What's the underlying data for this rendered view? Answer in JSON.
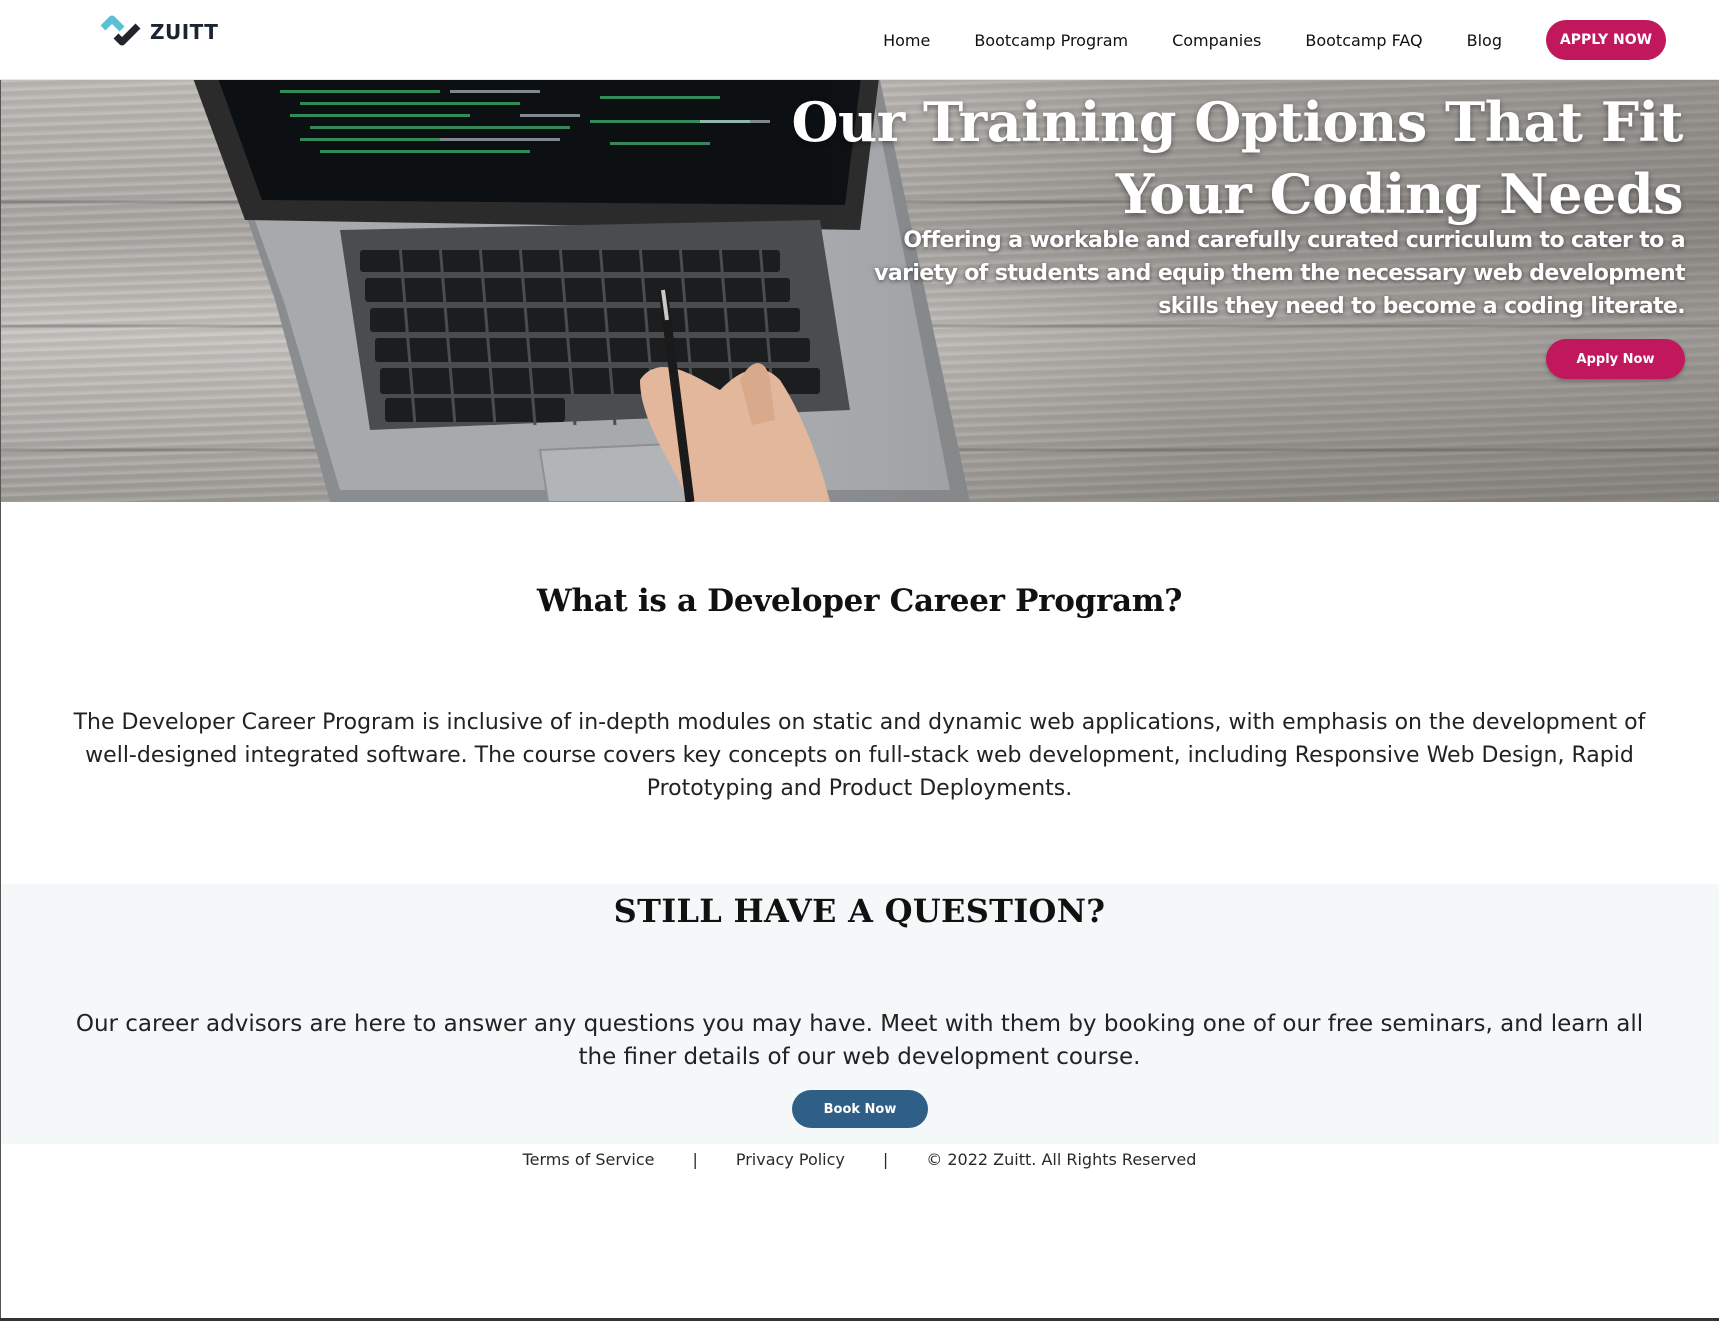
{
  "brand": {
    "name": "ZUITT"
  },
  "nav": {
    "links": [
      "Home",
      "Bootcamp Program",
      "Companies",
      "Bootcamp FAQ",
      "Blog"
    ],
    "apply_label": "APPLY NOW"
  },
  "hero": {
    "title_line1": "Our Training Options That Fit",
    "title_line2": "Your Coding Needs",
    "subtitle": "Offering a workable and carefully curated curriculum to cater to a variety of students and equip them the necessary web development skills they need to become a coding literate.",
    "apply_label": "Apply Now"
  },
  "program": {
    "title": "What is a Developer Career Program?",
    "text": "The Developer Career Program is inclusive of in-depth modules on static and dynamic web applications, with emphasis on the development of well-designed integrated software. The course covers key concepts on full-stack web development, including Responsive Web Design, Rapid Prototyping and Product Deployments."
  },
  "question": {
    "title": "STILL HAVE A QUESTION?",
    "text": "Our career advisors are here to answer any questions you may have. Meet with them by booking one of our free seminars, and learn all the finer details of our web development course.",
    "book_label": "Book Now"
  },
  "footer": {
    "terms": "Terms of Service",
    "separator": "|",
    "privacy": "Privacy Policy",
    "copyright": "© 2022 Zuitt. All Rights Reserved"
  },
  "colors": {
    "accent_pink": "#c0175d",
    "button_blue": "#2f5f86",
    "question_bg": "#f4f8f9",
    "logo_teal": "#5bbfd6"
  }
}
